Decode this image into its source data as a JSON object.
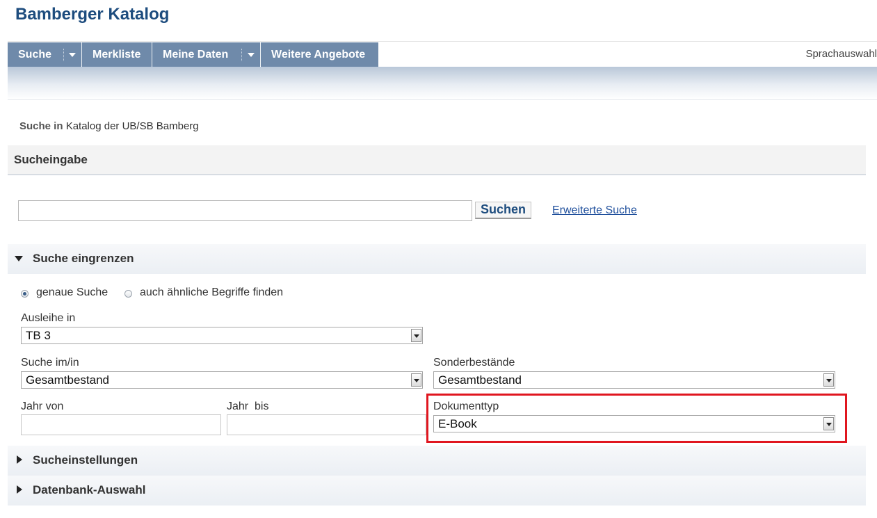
{
  "header": {
    "title": "Bamberger Katalog"
  },
  "nav": {
    "items": [
      {
        "label": "Suche"
      },
      {
        "label": "Merkliste"
      },
      {
        "label": "Meine Daten"
      },
      {
        "label": "Weitere Angebote"
      }
    ],
    "language": "Sprachauswahl"
  },
  "context": {
    "prefix": "Suche in",
    "catalog": "Katalog der UB/SB Bamberg"
  },
  "sections": {
    "input": "Sucheingabe",
    "narrow": "Suche eingrenzen",
    "settings": "Sucheinstellungen",
    "database": "Datenbank-Auswahl"
  },
  "search": {
    "value": "",
    "button": "Suchen",
    "advanced": "Erweiterte Suche"
  },
  "mode": {
    "exact": "genaue Suche",
    "similar": "auch ähnliche Begriffe finden",
    "selected": "exact"
  },
  "filters": {
    "loan": {
      "label": "Ausleihe in",
      "value": "TB 3"
    },
    "scope": {
      "label": "Suche im/in",
      "value": "Gesamtbestand"
    },
    "special": {
      "label": "Sonderbestände",
      "value": "Gesamtbestand"
    },
    "year_from": {
      "label": "Jahr von",
      "value": ""
    },
    "year_to": {
      "label": "Jahr  bis",
      "value": ""
    },
    "doctype": {
      "label": "Dokumenttyp",
      "value": "E-Book"
    }
  },
  "colors": {
    "nav": "#6f8aaa",
    "title": "#1d4c7e",
    "highlight": "#e0161f",
    "link": "#1f4f9c"
  }
}
